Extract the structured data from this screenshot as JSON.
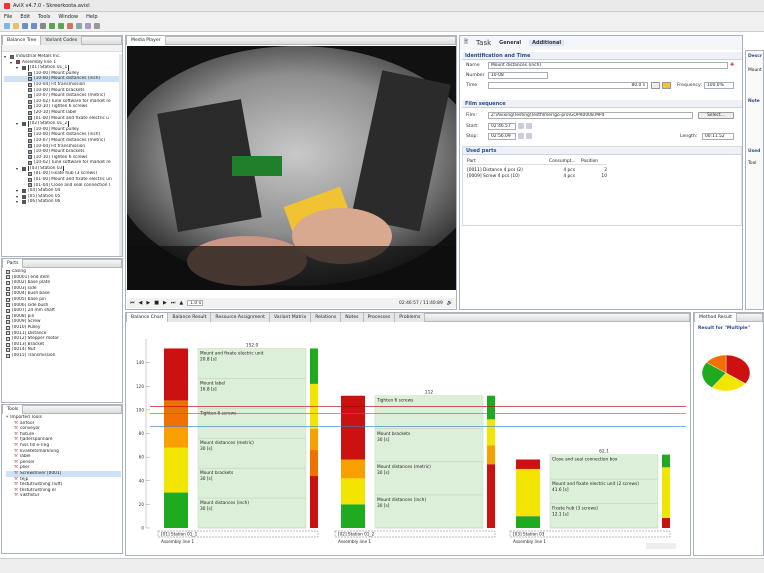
{
  "window": {
    "title": "AviX v4.7.0 - Skreerkoota.avixl"
  },
  "menu": [
    "File",
    "Edit",
    "Tools",
    "Window",
    "Help"
  ],
  "left_top": {
    "tabs": [
      "Balance Tree",
      "Variant Codes"
    ],
    "tree": [
      {
        "label": "Industrial Metals Inc.",
        "level": 0,
        "color": "#6a6a6a"
      },
      {
        "label": "Assembly line 1",
        "level": 1,
        "color": "#b33"
      },
      {
        "label": "[01] Station 01_1",
        "level": 2,
        "color": "#555",
        "selected": true
      },
      {
        "label": "[10-00] Mount pulley",
        "level": 3
      },
      {
        "label": "[10-00] Mount distances (inch)",
        "level": 3,
        "selected": true
      },
      {
        "label": "[10-04] Fit transmission",
        "level": 3
      },
      {
        "label": "[10-00] Mount brackets",
        "level": 3
      },
      {
        "label": "[10-07] Mount distances (metric)",
        "level": 3
      },
      {
        "label": "[10-02] Tune software for market re",
        "level": 3
      },
      {
        "label": "[10-10] Tighten 6 screws",
        "level": 3
      },
      {
        "label": "[20-10] Mount label",
        "level": 3
      },
      {
        "label": "[01-00] Mount and fixate electric u",
        "level": 3
      },
      {
        "label": "[02] Station 01_2",
        "level": 2,
        "color": "#555",
        "selected": true
      },
      {
        "label": "[10-00] Mount pulley",
        "level": 3
      },
      {
        "label": "[10-00] Mount distances (inch)",
        "level": 3
      },
      {
        "label": "[10-07] Mount distances (metric)",
        "level": 3
      },
      {
        "label": "[10-04] Fit transmission",
        "level": 3
      },
      {
        "label": "[10-00] Mount brackets",
        "level": 3
      },
      {
        "label": "[10-10] Tighten 6 screws",
        "level": 3
      },
      {
        "label": "[10-02] Tune software for market re",
        "level": 3
      },
      {
        "label": "[03] Station 03",
        "level": 2,
        "color": "#555",
        "selected": true
      },
      {
        "label": "[01-00] Fixate hub (3 screws)",
        "level": 3
      },
      {
        "label": "[01-00] Mount and fixate electric un",
        "level": 3
      },
      {
        "label": "[01-04] Close and seal connection l",
        "level": 3
      },
      {
        "label": "[04] Station 04",
        "level": 2,
        "color": "#555"
      },
      {
        "label": "[05] Station 05",
        "level": 2,
        "color": "#555"
      },
      {
        "label": "[06] Station 06",
        "level": 2,
        "color": "#555"
      }
    ]
  },
  "parts": {
    "title": "Parts",
    "items": [
      "casing",
      "[00001] end item",
      "[0002] base plate",
      "[0003] side",
      "[0004] bush base",
      "[0005] base pin",
      "[0006] side bush",
      "[0007] 24 mm shaft",
      "[0008] pin",
      "[0009] Screw",
      "[0010] Pulley",
      "[0011] Distance",
      "[0012] Stepper motor",
      "[0013] Bracket",
      "[0014] Nut",
      "[0015] Transmission"
    ]
  },
  "tools": {
    "title": "Tools",
    "items": [
      "Imported Tools",
      "airtool",
      "conveyor",
      "fixture",
      "fjäderspännare",
      "hiss till e-ring",
      "kvalitetsmärkning",
      "label",
      "pensel",
      "plier",
      "Screwdriver [0001]",
      "tejp",
      "testutrustning (luft)",
      "testutrustning el",
      "viktfixtur"
    ],
    "selected_index": 10
  },
  "media_player": {
    "tab": "Media Player",
    "speed": "1.0 x",
    "time": "02:46:57 / 11:40:89"
  },
  "task": {
    "title": "Task",
    "tabs": [
      "General",
      "Additional"
    ],
    "identification": {
      "section": "Identification and Time",
      "name_label": "Name",
      "name_value": "Mount distances (inch)",
      "number_label": "Number",
      "number_value": "10-08",
      "time_label": "Time",
      "time_value": "80.0 s",
      "frequency_label": "Frequency:",
      "frequency_value": "100.0%"
    },
    "film": {
      "section": "Film sequence",
      "film_label": "Film:",
      "film_path": "Z:\\Avixing\\Testing\\Testfilmer\\go-pro\\GOPR0008.MP4",
      "select_label": "Select...",
      "start_label": "Start:",
      "start_value": "02:46.57",
      "stop_label": "Stop:",
      "stop_value": "02:56.09",
      "length_label": "Length:",
      "length_value": "00:11.52"
    },
    "used_parts": {
      "section": "Used parts",
      "columns": [
        "Part",
        "Consumpt...",
        "Position"
      ],
      "rows": [
        [
          "[0011] Distance 4 pcs (2)",
          "4 pcs",
          "2"
        ],
        [
          "[0009] Screw 4 pcs (10)",
          "4 pcs",
          "10"
        ]
      ]
    }
  },
  "right_peek": {
    "descr": "Descr",
    "mount": "Mount",
    "notes": "Note",
    "used": "Used",
    "tool": "Tool"
  },
  "bottom": {
    "tabs": [
      "Balance Chart",
      "Balance Result",
      "Resource Assignment",
      "Variant Matrix",
      "Relations",
      "Notes",
      "Processes",
      "Problems"
    ],
    "method_tab": "Method Result",
    "method_title": "Result for \"Multiple\""
  },
  "chart_data": {
    "type": "bar",
    "title": "",
    "ylim": [
      0,
      160
    ],
    "yticks": [
      0,
      20,
      40,
      60,
      80,
      100,
      120,
      140
    ],
    "stations": [
      {
        "name": "[01] Station 01_1",
        "line": "Assembly line 1",
        "total": "152.0",
        "left_stack": [
          {
            "value": 30,
            "color": "#1faa1f"
          },
          {
            "value": 38,
            "color": "#f2e600"
          },
          {
            "value": 18,
            "color": "#f7a000"
          },
          {
            "value": 22,
            "color": "#f07000"
          },
          {
            "value": 44,
            "color": "#cc1111"
          }
        ],
        "tasks": [
          {
            "label": "Mount distances (inch)",
            "time": "30 [s]"
          },
          {
            "label": "Mount brackets",
            "time": "30 [s]"
          },
          {
            "label": "Mount distances (metric)",
            "time": "30 [s]"
          },
          {
            "label": "Tighten 6 screws",
            "time": ""
          },
          {
            "label": "Mount label",
            "time": "16.8 [s]"
          },
          {
            "label": "Mount and fixate electric unit",
            "time": "20.8 [s]"
          }
        ]
      },
      {
        "name": "[02] Station 01_2",
        "line": "Assembly line 1",
        "total": "112",
        "left_stack": [
          {
            "value": 20,
            "color": "#1faa1f"
          },
          {
            "value": 22,
            "color": "#f2e600"
          },
          {
            "value": 16,
            "color": "#f7a000"
          },
          {
            "value": 54,
            "color": "#cc1111"
          }
        ],
        "tasks": [
          {
            "label": "Mount distances (inch)",
            "time": "30 [s]"
          },
          {
            "label": "Mount distances (metric)",
            "time": "30 [s]"
          },
          {
            "label": "Mount brackets",
            "time": "30 [s]"
          },
          {
            "label": "Tighten 6 screws",
            "time": ""
          }
        ]
      },
      {
        "name": "[03] Station 03",
        "line": "Assembly line 1",
        "total": "62.1",
        "left_stack": [
          {
            "value": 10,
            "color": "#1faa1f"
          },
          {
            "value": 40,
            "color": "#f2e600"
          },
          {
            "value": 8,
            "color": "#cc1111"
          }
        ],
        "tasks": [
          {
            "label": "Fixate hub (3 screws)",
            "time": "12.1 [s]"
          },
          {
            "label": "Mount and fixate electric unit (2 screws)",
            "time": "41.6 [s]"
          },
          {
            "label": "Close and seal connection box",
            "time": ""
          }
        ]
      }
    ],
    "lines": [
      {
        "y": 97,
        "color": "#3a7bd5"
      },
      {
        "y": 103,
        "color": "#b30000"
      },
      {
        "y": 86,
        "color": "#3a7bd5"
      }
    ],
    "pie": {
      "slices": [
        {
          "value": 35,
          "color": "#cc1111"
        },
        {
          "value": 25,
          "color": "#f2e600"
        },
        {
          "value": 25,
          "color": "#1faa1f"
        },
        {
          "value": 15,
          "color": "#f07000"
        }
      ]
    }
  }
}
